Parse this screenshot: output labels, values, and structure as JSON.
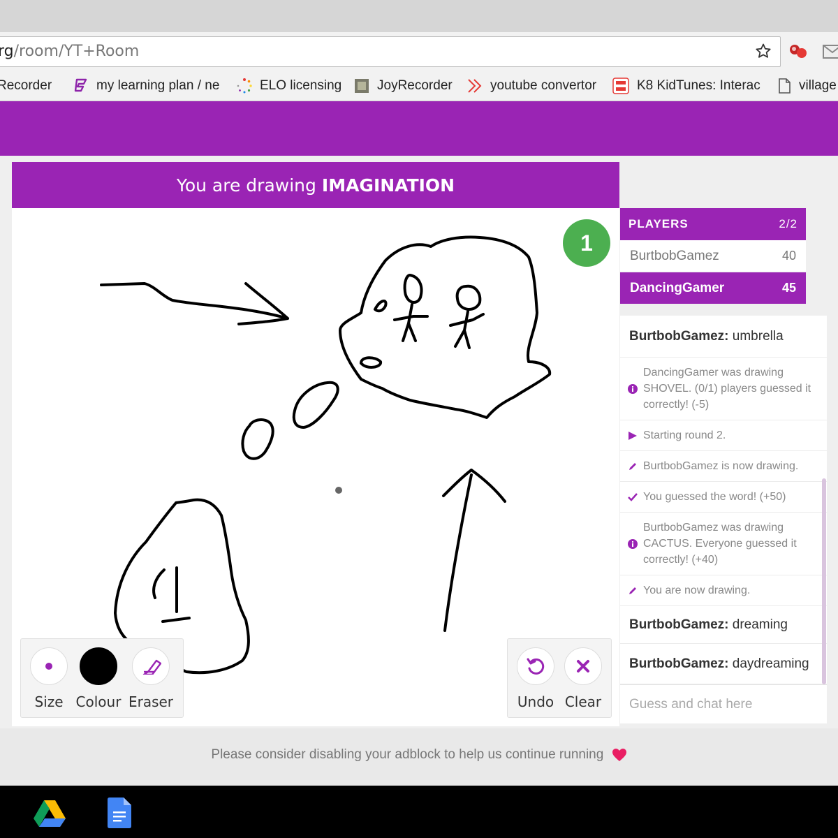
{
  "browser": {
    "url_host": "rg",
    "url_path": "/room/YT+Room",
    "bookmarks": [
      {
        "label": "Recorder F",
        "icon": "none"
      },
      {
        "label": "my learning plan / ne",
        "icon": "learning-plan-icon"
      },
      {
        "label": "ELO licensing",
        "icon": "loading-spinner-icon"
      },
      {
        "label": "JoyRecorder",
        "icon": "app-icon"
      },
      {
        "label": "youtube convertor",
        "icon": "double-chevron-icon"
      },
      {
        "label": "K8 KidTunes: Interac",
        "icon": "mk8-icon"
      },
      {
        "label": "village",
        "icon": "document-icon"
      }
    ]
  },
  "game": {
    "header_prefix": "You are drawing",
    "header_word": "IMAGINATION",
    "round_number": "1",
    "tools": {
      "size_label": "Size",
      "colour_label": "Colour",
      "eraser_label": "Eraser",
      "undo_label": "Undo",
      "clear_label": "Clear"
    },
    "colors": {
      "accent": "#9a24b4",
      "round_badge": "#4caf50",
      "brush": "#000000"
    }
  },
  "players": {
    "title": "PLAYERS",
    "count": "2/2",
    "list": [
      {
        "name": "BurtbobGamez",
        "score": "40"
      },
      {
        "name": "DancingGamer",
        "score": "45"
      }
    ]
  },
  "chat": {
    "messages": [
      {
        "type": "user",
        "user": "BurtbobGamez:",
        "text": " umbrella"
      },
      {
        "type": "sys",
        "icon": "info-icon",
        "text": "DancingGamer was drawing SHOVEL. (0/1) players guessed it correctly! (-5)"
      },
      {
        "type": "sys",
        "icon": "play-icon",
        "text": "Starting round 2."
      },
      {
        "type": "sys",
        "icon": "pencil-icon",
        "text": "BurtbobGamez is now drawing."
      },
      {
        "type": "sys",
        "icon": "check-icon",
        "text": "You guessed the word! (+50)"
      },
      {
        "type": "sys",
        "icon": "info-icon",
        "text": "BurtbobGamez was drawing CACTUS. Everyone guessed it correctly! (+40)"
      },
      {
        "type": "sys",
        "icon": "pencil-icon",
        "text": "You are now drawing."
      },
      {
        "type": "user",
        "user": "BurtbobGamez:",
        "text": " dreaming"
      },
      {
        "type": "user",
        "user": "BurtbobGamez:",
        "text": " daydreaming"
      }
    ],
    "input_placeholder": "Guess and chat here"
  },
  "footer": {
    "adblock_text": "Please consider disabling your adblock to help us continue running"
  }
}
